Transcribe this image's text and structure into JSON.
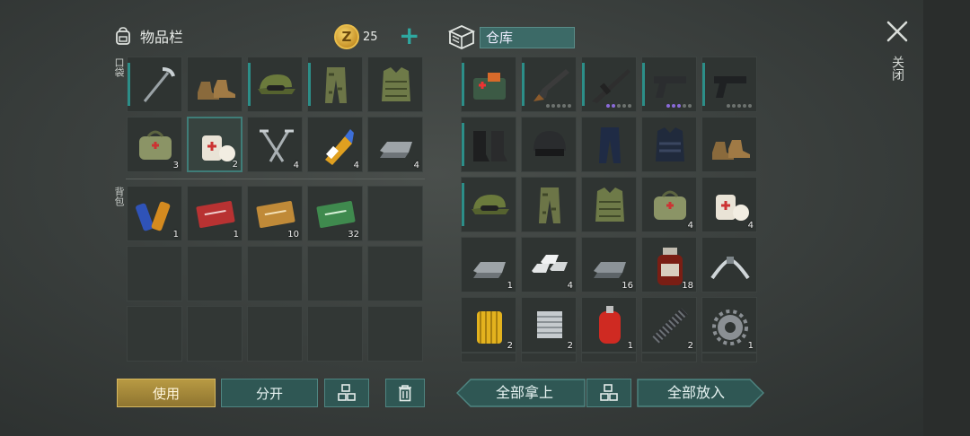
{
  "inventory": {
    "title": "物品栏",
    "coin_symbol": "Z",
    "coins": "25",
    "add_symbol": "+",
    "pocket_label": "口袋",
    "backpack_label": "背包",
    "pocket_items": [
      {
        "icon": "pickaxe-icon",
        "qty": ""
      },
      {
        "icon": "boots-icon",
        "qty": ""
      },
      {
        "icon": "camo-cap-icon",
        "qty": ""
      },
      {
        "icon": "camo-pants-icon",
        "qty": ""
      },
      {
        "icon": "camo-vest-icon",
        "qty": ""
      },
      {
        "icon": "medkit-bag-icon",
        "qty": "3"
      },
      {
        "icon": "bandage-icon",
        "qty": "2"
      },
      {
        "icon": "nails-icon",
        "qty": "4"
      },
      {
        "icon": "glue-icon",
        "qty": "4"
      },
      {
        "icon": "iron-ingot-icon",
        "qty": "4"
      }
    ],
    "backpack_items": [
      {
        "icon": "batteries-icon",
        "qty": "1"
      },
      {
        "icon": "combat-gear-coupon-icon",
        "qty": "1"
      },
      {
        "icon": "gold-coupon-icon",
        "qty": "10"
      },
      {
        "icon": "ration-coupon-icon",
        "qty": "32"
      }
    ]
  },
  "warehouse": {
    "title": "仓库",
    "items": [
      {
        "icon": "medkit-box-icon",
        "qty": ""
      },
      {
        "icon": "shotgun-icon",
        "qty": ""
      },
      {
        "icon": "assault-rifle-icon",
        "qty": ""
      },
      {
        "icon": "pistol-icon",
        "qty": ""
      },
      {
        "icon": "pistol-dark-icon",
        "qty": ""
      },
      {
        "icon": "combat-boots-icon",
        "qty": ""
      },
      {
        "icon": "helmet-icon",
        "qty": ""
      },
      {
        "icon": "police-pants-icon",
        "qty": ""
      },
      {
        "icon": "police-vest-icon",
        "qty": ""
      },
      {
        "icon": "boots-icon",
        "qty": ""
      },
      {
        "icon": "camo-cap-icon",
        "qty": ""
      },
      {
        "icon": "camo-pants-icon",
        "qty": ""
      },
      {
        "icon": "camo-vest-icon",
        "qty": ""
      },
      {
        "icon": "medkit-bag-icon",
        "qty": "4"
      },
      {
        "icon": "bandage-icon",
        "qty": "4"
      },
      {
        "icon": "iron-ingot-icon",
        "qty": "1"
      },
      {
        "icon": "aluminum-ingots-icon",
        "qty": "4"
      },
      {
        "icon": "steel-ingot-icon",
        "qty": "16"
      },
      {
        "icon": "medicine-bottle-icon",
        "qty": "18"
      },
      {
        "icon": "handlebar-icon",
        "qty": ""
      },
      {
        "icon": "oil-filter-icon",
        "qty": "2"
      },
      {
        "icon": "engine-cylinder-icon",
        "qty": "2"
      },
      {
        "icon": "gas-canister-icon",
        "qty": "1"
      },
      {
        "icon": "spring-icon",
        "qty": "2"
      },
      {
        "icon": "gear-icon",
        "qty": "1"
      }
    ]
  },
  "close_label": "关闭",
  "buttons": {
    "use": "使用",
    "split": "分开",
    "take_all": "全部拿上",
    "put_all": "全部放入"
  },
  "colors": {
    "accent_teal": "#2c8e88",
    "use_gold": "#b89a43",
    "rarity_purple": "#8a6ad8"
  }
}
